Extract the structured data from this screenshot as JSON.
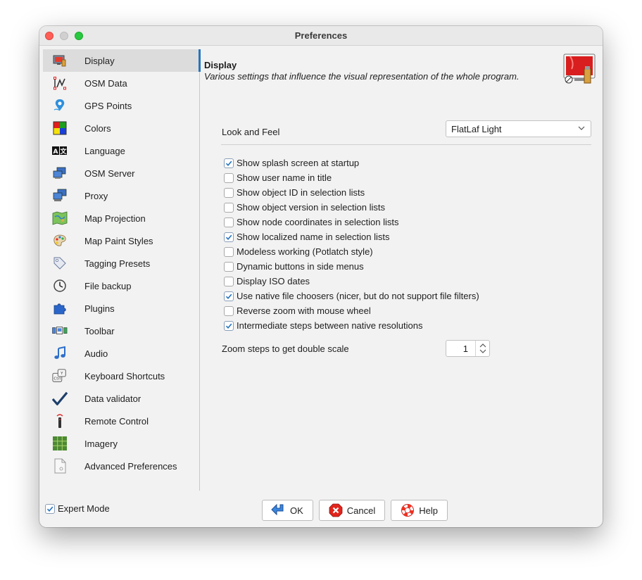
{
  "window": {
    "title": "Preferences"
  },
  "sidebar": {
    "items": [
      {
        "label": "Display",
        "icon": "display-icon"
      },
      {
        "label": "OSM Data",
        "icon": "osm-data-icon"
      },
      {
        "label": "GPS Points",
        "icon": "gps-pin-icon"
      },
      {
        "label": "Colors",
        "icon": "colors-icon"
      },
      {
        "label": "Language",
        "icon": "language-icon"
      },
      {
        "label": "OSM Server",
        "icon": "server-icon"
      },
      {
        "label": "Proxy",
        "icon": "proxy-icon"
      },
      {
        "label": "Map Projection",
        "icon": "map-icon"
      },
      {
        "label": "Map Paint Styles",
        "icon": "palette-icon"
      },
      {
        "label": "Tagging Presets",
        "icon": "tag-icon"
      },
      {
        "label": "File backup",
        "icon": "clock-icon"
      },
      {
        "label": "Plugins",
        "icon": "puzzle-icon"
      },
      {
        "label": "Toolbar",
        "icon": "toolbar-icon"
      },
      {
        "label": "Audio",
        "icon": "music-note-icon"
      },
      {
        "label": "Keyboard Shortcuts",
        "icon": "keyboard-icon"
      },
      {
        "label": "Data validator",
        "icon": "checkmark-icon"
      },
      {
        "label": "Remote Control",
        "icon": "remote-icon"
      },
      {
        "label": "Imagery",
        "icon": "grid-icon"
      },
      {
        "label": "Advanced Preferences",
        "icon": "document-icon"
      }
    ],
    "selected": "Display"
  },
  "panel": {
    "title": "Display",
    "description": "Various settings that influence the visual representation of the whole program.",
    "icon": "display-paint-icon",
    "look_and_feel": {
      "label": "Look and Feel",
      "value": "FlatLaf Light"
    },
    "checkboxes": [
      {
        "label": "Show splash screen at startup",
        "checked": true
      },
      {
        "label": "Show user name in title",
        "checked": false
      },
      {
        "label": "Show object ID in selection lists",
        "checked": false
      },
      {
        "label": "Show object version in selection lists",
        "checked": false
      },
      {
        "label": "Show node coordinates in selection lists",
        "checked": false
      },
      {
        "label": "Show localized name in selection lists",
        "checked": true
      },
      {
        "label": "Modeless working (Potlatch style)",
        "checked": false
      },
      {
        "label": "Dynamic buttons in side menus",
        "checked": false
      },
      {
        "label": "Display ISO dates",
        "checked": false
      },
      {
        "label": "Use native file choosers (nicer, but do not support file filters)",
        "checked": true
      },
      {
        "label": "Reverse zoom with mouse wheel",
        "checked": false
      },
      {
        "label": "Intermediate steps between native resolutions",
        "checked": true
      }
    ],
    "zoom_steps": {
      "label": "Zoom steps to get double scale",
      "value": "1"
    }
  },
  "footer": {
    "expert_mode": {
      "label": "Expert Mode",
      "checked": true
    },
    "ok_label": "OK",
    "cancel_label": "Cancel",
    "help_label": "Help"
  },
  "colors": {
    "accent": "#2675bf",
    "selected_row": "#dcdcdc",
    "background": "#f2f2f2"
  }
}
